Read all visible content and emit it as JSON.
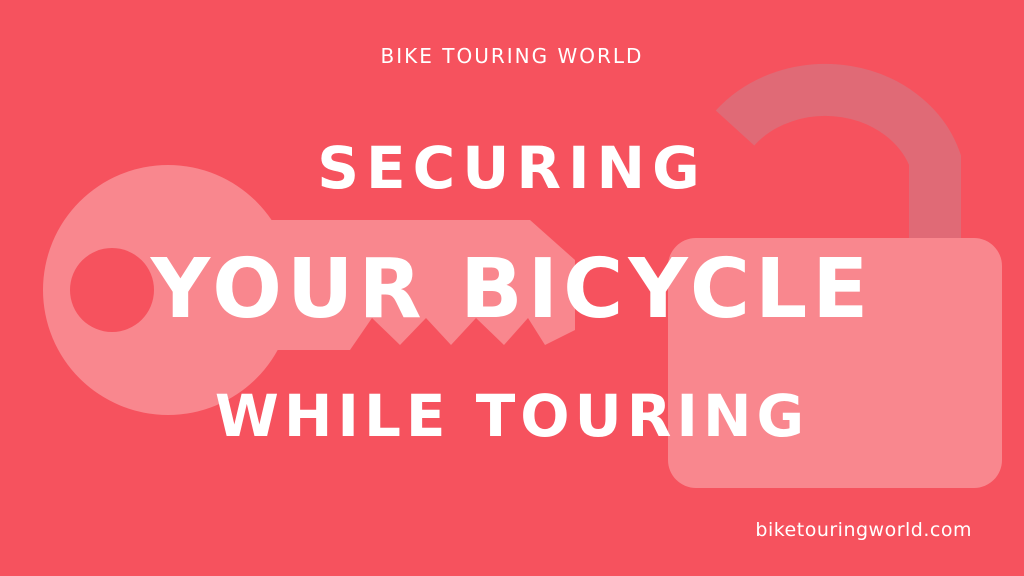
{
  "colors": {
    "background": "#f6525e",
    "shape_fill": "#f9878e",
    "shackle": "#e06a76",
    "text": "#ffffff"
  },
  "brand": "BIKE TOURING WORLD",
  "title": {
    "line1": "SECURING",
    "line2": "YOUR BICYCLE",
    "line3": "WHILE TOURING"
  },
  "website": "biketouringworld.com",
  "icons": [
    "key-icon",
    "padlock-icon"
  ]
}
